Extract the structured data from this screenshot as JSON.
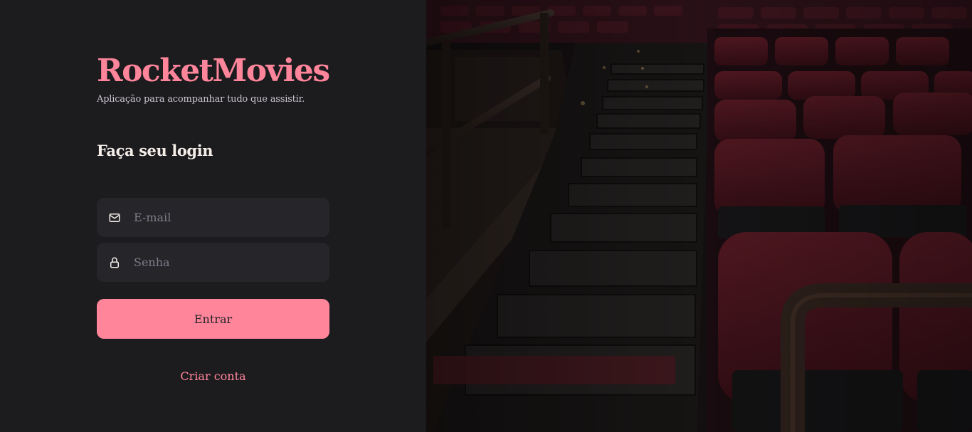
{
  "brand": {
    "title": "RocketMovies",
    "tagline": "Aplicação para acompanhar tudo que assistir."
  },
  "login": {
    "heading": "Faça seu login",
    "email": {
      "placeholder": "E-mail",
      "value": "",
      "icon": "mail-icon"
    },
    "password": {
      "placeholder": "Senha",
      "value": "",
      "icon": "lock-icon"
    },
    "submit_label": "Entrar",
    "create_account_label": "Criar conta"
  },
  "background": {
    "subject": "cinema-theater-seats"
  },
  "colors": {
    "background": "#1C1B1E",
    "accent": "#FF859B",
    "input_bg": "#262529",
    "text": "#F4EDE8",
    "muted": "#CAC4CF",
    "placeholder": "#7C7C8A"
  }
}
